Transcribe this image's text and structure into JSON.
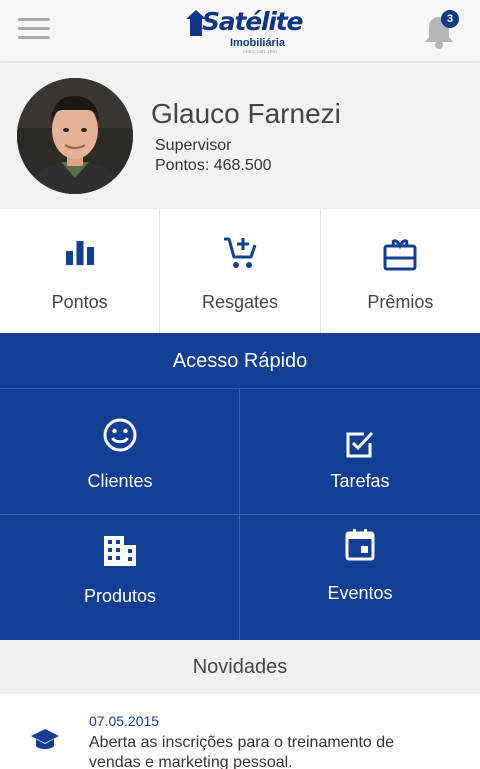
{
  "header": {
    "logo": {
      "brand": "Satélite",
      "subtitle": "Imobiliária",
      "creci": "CRECI 2387-J RIO"
    },
    "notifications_count": "3"
  },
  "profile": {
    "name": "Glauco Farnezi",
    "role": "Supervisor",
    "points": "Pontos: 468.500"
  },
  "stats": [
    {
      "label": "Pontos",
      "icon": "bar-chart-icon"
    },
    {
      "label": "Resgates",
      "icon": "cart-add-icon"
    },
    {
      "label": "Prêmios",
      "icon": "gift-card-icon"
    }
  ],
  "quick_access": {
    "title": "Acesso Rápido",
    "tiles": [
      {
        "label": "Clientes",
        "icon": "smiley-icon"
      },
      {
        "label": "Tarefas",
        "icon": "checkbox-icon"
      },
      {
        "label": "Produtos",
        "icon": "building-icon"
      },
      {
        "label": "Eventos",
        "icon": "calendar-icon"
      }
    ]
  },
  "news": {
    "title": "Novidades",
    "items": [
      {
        "date": "07.05.2015",
        "text": "Aberta as inscrições para o treinamento de vendas e marketing pessoal.",
        "icon": "graduation-cap-icon"
      }
    ]
  },
  "colors": {
    "primary": "#103f93",
    "header_bg": "#f7f7f7",
    "text": "#444444"
  }
}
